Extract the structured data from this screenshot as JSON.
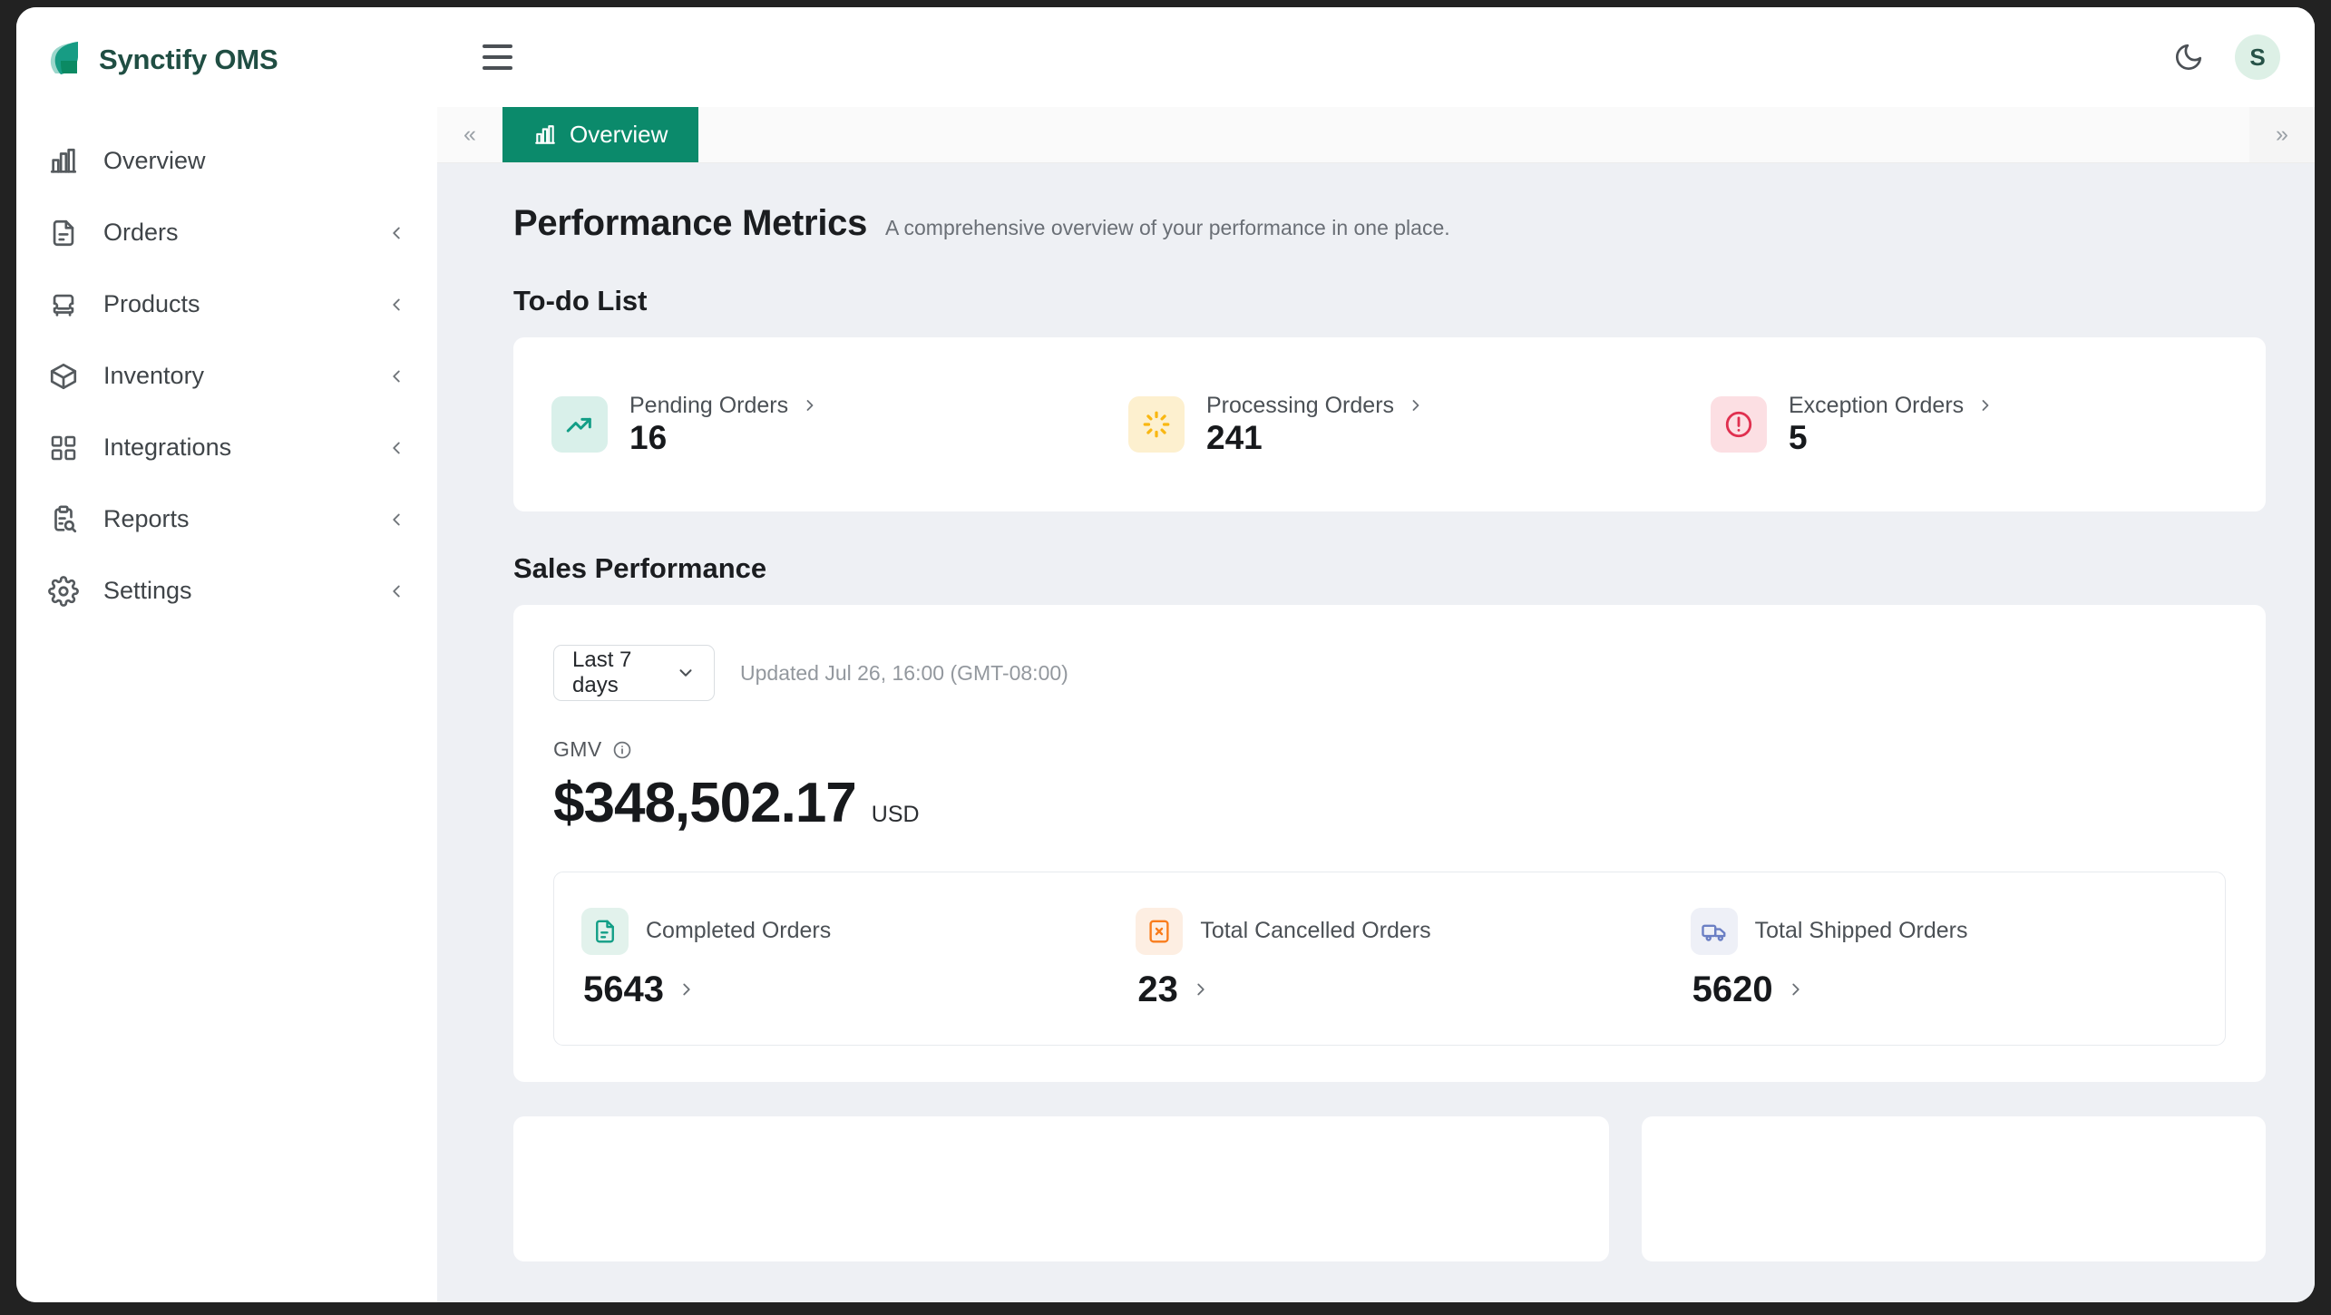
{
  "app": {
    "brand_name": "Synctify OMS",
    "logo_icon": "leaf-logo-icon",
    "accent_color": "#0b8a6b",
    "avatar_initial": "S",
    "theme_toggle_icon": "moon-icon",
    "menu_icon": "hamburger-icon"
  },
  "sidebar": {
    "items": [
      {
        "label": "Overview",
        "icon": "bar-chart-icon",
        "has_chevron": false
      },
      {
        "label": "Orders",
        "icon": "document-icon",
        "has_chevron": true
      },
      {
        "label": "Products",
        "icon": "armchair-icon",
        "has_chevron": true
      },
      {
        "label": "Inventory",
        "icon": "box-icon",
        "has_chevron": true
      },
      {
        "label": "Integrations",
        "icon": "grid-apps-icon",
        "has_chevron": true
      },
      {
        "label": "Reports",
        "icon": "clipboard-search-icon",
        "has_chevron": true
      },
      {
        "label": "Settings",
        "icon": "gear-icon",
        "has_chevron": true
      }
    ]
  },
  "tabstrip": {
    "scroll_left_icon": "chevrons-left-icon",
    "scroll_right_icon": "chevrons-right-icon",
    "tabs": [
      {
        "label": "Overview",
        "icon": "bar-chart-icon",
        "active": true
      }
    ]
  },
  "page": {
    "title": "Performance Metrics",
    "subtitle": "A comprehensive overview of your performance in one place."
  },
  "todo": {
    "section_title": "To-do List",
    "items": [
      {
        "label": "Pending Orders",
        "value": "16",
        "icon": "trending-up-icon",
        "icon_color": "#129e86",
        "icon_bg": "#d9f0ea",
        "chevron_icon": "chevron-right-icon"
      },
      {
        "label": "Processing Orders",
        "value": "241",
        "icon": "spinner-icon",
        "icon_color": "#f9b712",
        "icon_bg": "#fdf0cf",
        "chevron_icon": "chevron-right-icon"
      },
      {
        "label": "Exception Orders",
        "value": "5",
        "icon": "alert-circle-icon",
        "icon_color": "#e0304f",
        "icon_bg": "#fcdfe3",
        "chevron_icon": "chevron-right-icon"
      }
    ]
  },
  "sales": {
    "section_title": "Sales Performance",
    "range_value": "Last 7 days",
    "range_caret_icon": "chevron-down-icon",
    "updated_text": "Updated Jul 26, 16:00 (GMT-08:00)",
    "gmv_label": "GMV",
    "gmv_info_icon": "info-circle-icon",
    "gmv_amount": "$348,502.17",
    "gmv_currency": "USD",
    "orders": [
      {
        "label": "Completed Orders",
        "value": "5643",
        "icon": "document-check-icon",
        "icon_color": "#129e86",
        "icon_bg": "#e2f2ec",
        "chevron_icon": "chevron-right-icon"
      },
      {
        "label": "Total Cancelled Orders",
        "value": "23",
        "icon": "box-x-icon",
        "icon_color": "#f97c1c",
        "icon_bg": "#fdeee2",
        "chevron_icon": "chevron-right-icon"
      },
      {
        "label": "Total Shipped Orders",
        "value": "5620",
        "icon": "truck-icon",
        "icon_color": "#6b7fc4",
        "icon_bg": "#eef0f7",
        "chevron_icon": "chevron-right-icon"
      }
    ]
  }
}
